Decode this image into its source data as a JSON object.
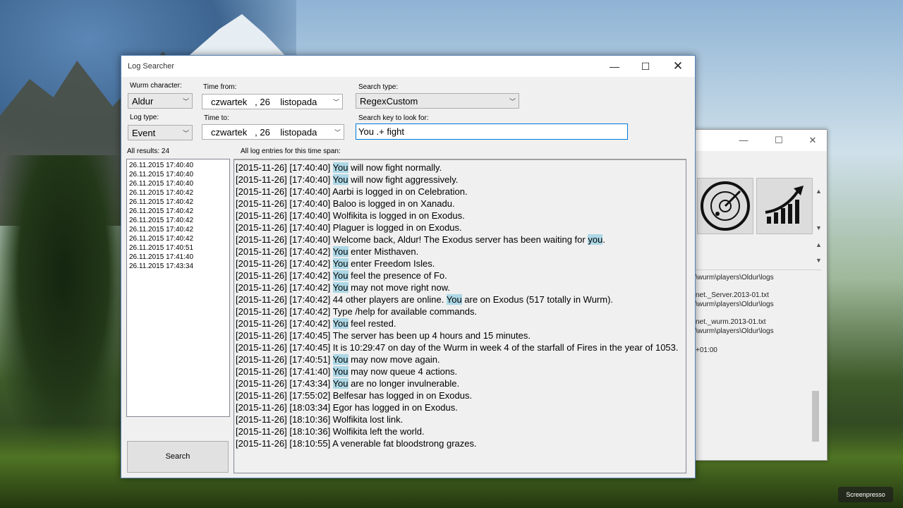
{
  "desktop": {
    "watermark": "Screenpresso"
  },
  "bg_window": {
    "min": "—",
    "max": "☐",
    "close": "✕",
    "text_lines": [
      "\\wurm\\players\\Oldur\\logs",
      "net._Server.2013-01.txt",
      "\\wurm\\players\\Oldur\\logs",
      "net._wurm.2013-01.txt",
      "\\wurm\\players\\Oldur\\logs",
      "+01:00"
    ]
  },
  "window": {
    "title": "Log Searcher",
    "min": "—",
    "max": "☐",
    "close": "✕"
  },
  "form": {
    "wurm_character_label": "Wurm character:",
    "wurm_character_value": "Aldur",
    "log_type_label": "Log type:",
    "log_type_value": "Event",
    "time_from_label": "Time from:",
    "time_from_value": "czwartek   , 26    listopada",
    "time_to_label": "Time to:",
    "time_to_value": "czwartek   , 26    listopada",
    "search_type_label": "Search type:",
    "search_type_value": "RegexCustom",
    "search_key_label": "Search key to look for:",
    "search_key_value": "You .+ fight",
    "all_results_label": "All results: 24",
    "all_entries_label": "All log entries for this time span:",
    "search_button": "Search"
  },
  "results": [
    "26.11.2015 17:40:40",
    "26.11.2015 17:40:40",
    "26.11.2015 17:40:40",
    "26.11.2015 17:40:42",
    "26.11.2015 17:40:42",
    "26.11.2015 17:40:42",
    "26.11.2015 17:40:42",
    "26.11.2015 17:40:42",
    "26.11.2015 17:40:42",
    "26.11.2015 17:40:51",
    "26.11.2015 17:41:40",
    "26.11.2015 17:43:34"
  ],
  "log_lines": [
    {
      "pre": "[2015-11-26] [17:40:40] ",
      "hl": "You",
      "post": " will now fight normally."
    },
    {
      "pre": "[2015-11-26] [17:40:40] ",
      "hl": "You",
      "post": " will now fight aggressively."
    },
    {
      "pre": "[2015-11-26] [17:40:40] Aarbi is logged in on Celebration.",
      "hl": "",
      "post": ""
    },
    {
      "pre": "[2015-11-26] [17:40:40] Baloo is logged in on Xanadu.",
      "hl": "",
      "post": ""
    },
    {
      "pre": "[2015-11-26] [17:40:40] Wolfikita is logged in on Exodus.",
      "hl": "",
      "post": ""
    },
    {
      "pre": "[2015-11-26] [17:40:40] Plaguer is logged in on Exodus.",
      "hl": "",
      "post": ""
    },
    {
      "pre": "[2015-11-26] [17:40:40] Welcome back, Aldur! The Exodus server has been waiting for ",
      "hl": "you",
      "post": "."
    },
    {
      "pre": "[2015-11-26] [17:40:42] ",
      "hl": "You",
      "post": " enter Misthaven."
    },
    {
      "pre": "[2015-11-26] [17:40:42] ",
      "hl": "You",
      "post": " enter Freedom Isles."
    },
    {
      "pre": "[2015-11-26] [17:40:42] ",
      "hl": "You",
      "post": " feel the presence of Fo."
    },
    {
      "pre": "[2015-11-26] [17:40:42] ",
      "hl": "You",
      "post": " may not move right now."
    },
    {
      "pre": "[2015-11-26] [17:40:42] 44 other players are online. ",
      "hl": "You",
      "post": " are on Exodus (517 totally in Wurm)."
    },
    {
      "pre": "[2015-11-26] [17:40:42] Type /help for available commands.",
      "hl": "",
      "post": ""
    },
    {
      "pre": "[2015-11-26] [17:40:42] ",
      "hl": "You",
      "post": " feel rested."
    },
    {
      "pre": "[2015-11-26] [17:40:45] The server has been up 4 hours and 15 minutes.",
      "hl": "",
      "post": ""
    },
    {
      "pre": "[2015-11-26] [17:40:45] It is 10:29:47 on day of the Wurm in week 4 of the starfall of Fires in the year of 1053.",
      "hl": "",
      "post": ""
    },
    {
      "pre": "[2015-11-26] [17:40:51] ",
      "hl": "You",
      "post": " may now move again."
    },
    {
      "pre": "[2015-11-26] [17:41:40] ",
      "hl": "You",
      "post": " may now queue 4 actions."
    },
    {
      "pre": "[2015-11-26] [17:43:34] ",
      "hl": "You",
      "post": " are no longer invulnerable."
    },
    {
      "pre": "[2015-11-26] [17:55:02] Belfesar has logged in on Exodus.",
      "hl": "",
      "post": ""
    },
    {
      "pre": "[2015-11-26] [18:03:34] Egor has logged in on Exodus.",
      "hl": "",
      "post": ""
    },
    {
      "pre": "[2015-11-26] [18:10:36] Wolfikita lost link.",
      "hl": "",
      "post": ""
    },
    {
      "pre": "[2015-11-26] [18:10:36] Wolfikita left the world.",
      "hl": "",
      "post": ""
    },
    {
      "pre": "[2015-11-26] [18:10:55] A venerable fat bloodstrong grazes.",
      "hl": "",
      "post": ""
    }
  ]
}
